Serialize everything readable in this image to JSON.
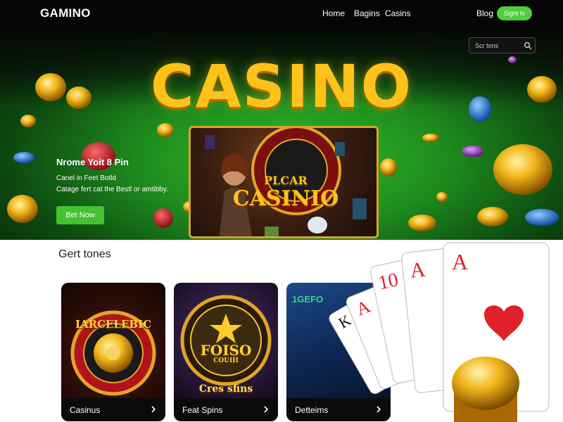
{
  "nav": {
    "logo": "GAMINO",
    "links": [
      "Home",
      "Bagins",
      "Casins"
    ],
    "blog": "Blog",
    "cta": "Sight tv"
  },
  "hero": {
    "title": "CASINO",
    "search_placeholder": "Scr tons",
    "headline": "Nrome Yoit 8 Pin",
    "sub1": "Canel in Feet Botld",
    "sub2": "Catage fert cat the Bestl or amtibby.",
    "button": "Bet Now",
    "art_title_line1": "PLCAR",
    "art_title_line2": "CASINIO"
  },
  "section": {
    "title": "Gert tones",
    "cards": [
      {
        "label": "Casinus",
        "art_text": "IARCELEBIC"
      },
      {
        "label": "Feat Spins",
        "art_text": "FOISO",
        "art_sub": "COUIII",
        "art_bottom": "Cres sfins"
      },
      {
        "label": "Detteims",
        "art_text": "1GEFO"
      }
    ]
  },
  "playing_cards": [
    "A",
    "A",
    "10",
    "K",
    "A"
  ],
  "colors": {
    "accent_green": "#44c230",
    "title_gold": "#ffc21a",
    "nav_bg": "#050505",
    "card_red": "#e0202a"
  }
}
